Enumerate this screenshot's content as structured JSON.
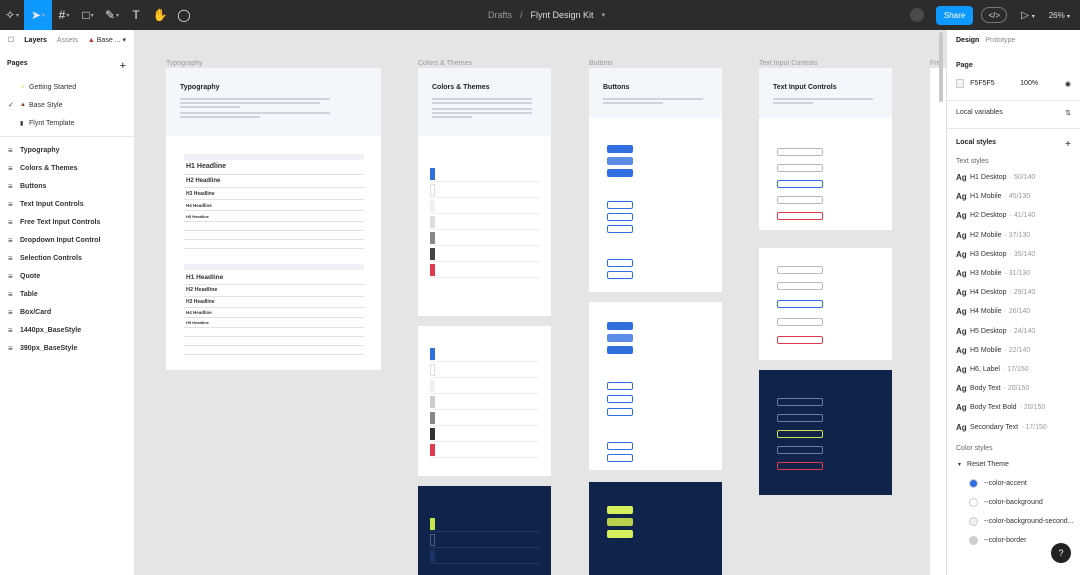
{
  "toolbar": {
    "breadcrumb_parent": "Drafts",
    "breadcrumb_sep": "/",
    "file_name": "Flynt Design Kit",
    "share_label": "Share",
    "devmode_label": "</>",
    "zoom": "26%"
  },
  "left_panel": {
    "tabs": [
      "Layers",
      "Assets",
      "Base ..."
    ],
    "pages_title": "Pages",
    "pages": [
      {
        "icon": "lightbulb",
        "label": "Getting Started"
      },
      {
        "icon": "hat",
        "label": "Base Style",
        "current": true
      },
      {
        "icon": "phone",
        "label": "Flynt Template"
      }
    ],
    "layers": [
      "Typography",
      "Colors & Themes",
      "Buttons",
      "Text Input Controls",
      "Free Text Input Controls",
      "Dropdown Input Control",
      "Selection Controls",
      "Quote",
      "Table",
      "Box/Card",
      "1440px_BaseStyle",
      "390px_BaseStyle"
    ]
  },
  "right_panel": {
    "tabs": [
      "Design",
      "Prototype"
    ],
    "page_section": "Page",
    "page_color": "F5F5F5",
    "page_opacity": "100%",
    "local_variables": "Local variables",
    "local_styles": "Local styles",
    "text_styles_label": "Text styles",
    "text_styles": [
      {
        "name": "H1 Desktop",
        "meta": "· 50/140"
      },
      {
        "name": "H1 Mobile",
        "meta": "· 45/130"
      },
      {
        "name": "H2 Desktop",
        "meta": "· 41/140"
      },
      {
        "name": "H2 Mobile",
        "meta": "· 37/130"
      },
      {
        "name": "H3 Desktop",
        "meta": "· 35/140"
      },
      {
        "name": "H3 Mobile",
        "meta": "· 31/130"
      },
      {
        "name": "H4 Desktop",
        "meta": "· 29/140"
      },
      {
        "name": "H4 Mobile",
        "meta": "· 26/140"
      },
      {
        "name": "H5 Desktop",
        "meta": "· 24/140"
      },
      {
        "name": "H5 Mobile",
        "meta": "· 22/140"
      },
      {
        "name": "H6, Label",
        "meta": "· 17/150"
      },
      {
        "name": "Body Text",
        "meta": "· 20/150"
      },
      {
        "name": "Body Text Bold",
        "meta": "· 20/150"
      },
      {
        "name": "Secondary Text",
        "meta": "· 17/150"
      }
    ],
    "color_styles_label": "Color styles",
    "color_group": "Reset Theme",
    "color_styles": [
      {
        "name": "--color-accent",
        "color": "#2f6fe0"
      },
      {
        "name": "--color-background",
        "color": "#ffffff"
      },
      {
        "name": "--color-background-second...",
        "color": "#f0f0f0"
      },
      {
        "name": "--color-border",
        "color": "#cfcfcf"
      }
    ]
  },
  "canvas": {
    "frame_labels": [
      "Typography",
      "Colors & Themes",
      "Buttons",
      "Text Input Controls",
      "Fre"
    ],
    "frame_titles": [
      "Typography",
      "Colors & Themes",
      "Buttons",
      "Text Input Controls"
    ],
    "typography_headings": [
      "H1 Headline",
      "H2 Headline",
      "H3 Headline",
      "H4 Headline",
      "H5 Headline"
    ],
    "typography_headings_2": [
      "H1 Headline",
      "H2 Headline",
      "H3 Headline",
      "H4 Headline",
      "H5 Headline"
    ]
  },
  "help_label": "?"
}
